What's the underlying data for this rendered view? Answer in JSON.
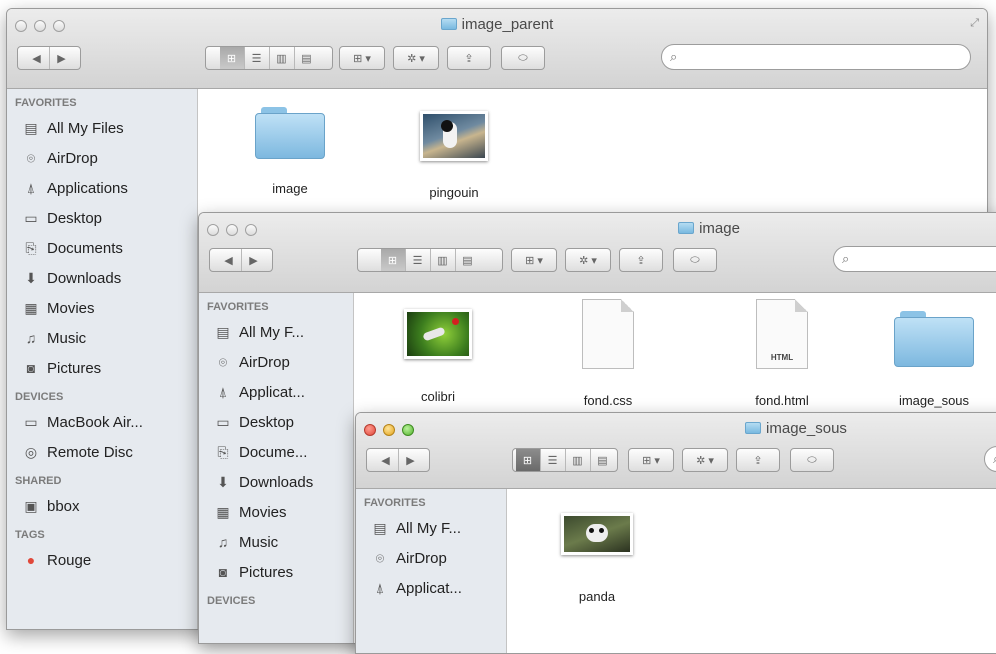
{
  "windows": [
    {
      "title": "image_parent",
      "sidebar": {
        "favorites_header": "FAVORITES",
        "favorites": [
          {
            "label": "All My Files",
            "icon": "all-files-icon"
          },
          {
            "label": "AirDrop",
            "icon": "airdrop-icon"
          },
          {
            "label": "Applications",
            "icon": "applications-icon"
          },
          {
            "label": "Desktop",
            "icon": "desktop-icon"
          },
          {
            "label": "Documents",
            "icon": "documents-icon"
          },
          {
            "label": "Downloads",
            "icon": "downloads-icon"
          },
          {
            "label": "Movies",
            "icon": "movies-icon"
          },
          {
            "label": "Music",
            "icon": "music-icon"
          },
          {
            "label": "Pictures",
            "icon": "pictures-icon"
          }
        ],
        "devices_header": "DEVICES",
        "devices": [
          {
            "label": "MacBook Air...",
            "icon": "laptop-icon"
          },
          {
            "label": "Remote Disc",
            "icon": "disc-icon"
          }
        ],
        "shared_header": "SHARED",
        "shared": [
          {
            "label": "bbox",
            "icon": "shared-computer-icon"
          }
        ],
        "tags_header": "TAGS",
        "tags": [
          {
            "label": "Rouge",
            "color": "#e0483a"
          }
        ]
      },
      "files": [
        {
          "name": "image",
          "type": "folder"
        },
        {
          "name": "pingouin",
          "type": "image"
        }
      ]
    },
    {
      "title": "image",
      "sidebar": {
        "favorites_header": "FAVORITES",
        "favorites": [
          {
            "label": "All My F...",
            "icon": "all-files-icon"
          },
          {
            "label": "AirDrop",
            "icon": "airdrop-icon"
          },
          {
            "label": "Applicat...",
            "icon": "applications-icon"
          },
          {
            "label": "Desktop",
            "icon": "desktop-icon"
          },
          {
            "label": "Docume...",
            "icon": "documents-icon"
          },
          {
            "label": "Downloads",
            "icon": "downloads-icon"
          },
          {
            "label": "Movies",
            "icon": "movies-icon"
          },
          {
            "label": "Music",
            "icon": "music-icon"
          },
          {
            "label": "Pictures",
            "icon": "pictures-icon"
          }
        ],
        "devices_header": "DEVICES"
      },
      "files": [
        {
          "name": "colibri",
          "type": "image"
        },
        {
          "name": "fond.css",
          "type": "document"
        },
        {
          "name": "fond.html",
          "type": "document",
          "tag": "HTML"
        },
        {
          "name": "image_sous",
          "type": "folder"
        }
      ]
    },
    {
      "title": "image_sous",
      "sidebar": {
        "favorites_header": "FAVORITES",
        "favorites": [
          {
            "label": "All My F...",
            "icon": "all-files-icon"
          },
          {
            "label": "AirDrop",
            "icon": "airdrop-icon"
          },
          {
            "label": "Applicat...",
            "icon": "applications-icon"
          }
        ]
      },
      "files": [
        {
          "name": "panda",
          "type": "image"
        }
      ]
    }
  ]
}
